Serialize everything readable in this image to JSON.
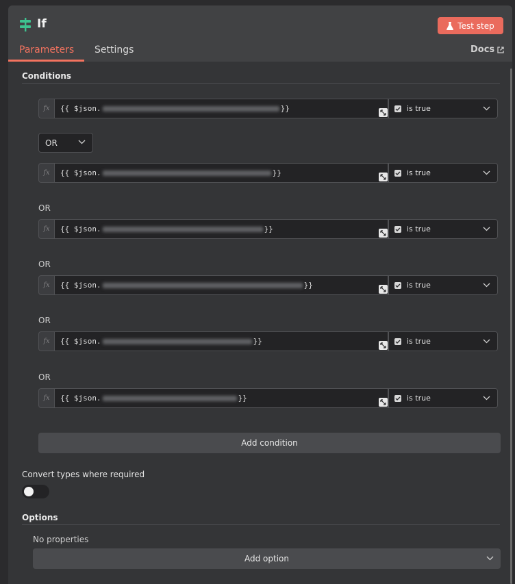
{
  "node": {
    "title": "If",
    "icon": "if-node-icon",
    "accent": "#3ec28f"
  },
  "header": {
    "test_step_label": "Test step",
    "docs_label": "Docs"
  },
  "tabs": [
    {
      "label": "Parameters",
      "active": true
    },
    {
      "label": "Settings",
      "active": false
    }
  ],
  "conditions": {
    "title": "Conditions",
    "combinator": "OR",
    "or_label": "OR",
    "rows": [
      {
        "prefix": "{{ $json.",
        "suffix": " }}",
        "operator": "is true"
      },
      {
        "prefix": "{{ $json.",
        "suffix": " }}",
        "operator": "is true"
      },
      {
        "prefix": "{{ $json.",
        "suffix": " }}",
        "operator": "is true"
      },
      {
        "prefix": "{{ $json.",
        "suffix": " }}",
        "operator": "is true"
      },
      {
        "prefix": "{{ $json.",
        "suffix": " }}",
        "operator": "is true"
      },
      {
        "prefix": "{{ $json.",
        "suffix": " }}",
        "operator": "is true"
      }
    ],
    "add_condition_label": "Add condition"
  },
  "convert_types": {
    "label": "Convert types where required",
    "enabled": false
  },
  "options": {
    "title": "Options",
    "empty_label": "No properties",
    "add_option_label": "Add option"
  },
  "colors": {
    "accent": "#ea6b5d",
    "active_tab": "#f4735f",
    "panel": "#414244",
    "content": "#343537"
  }
}
